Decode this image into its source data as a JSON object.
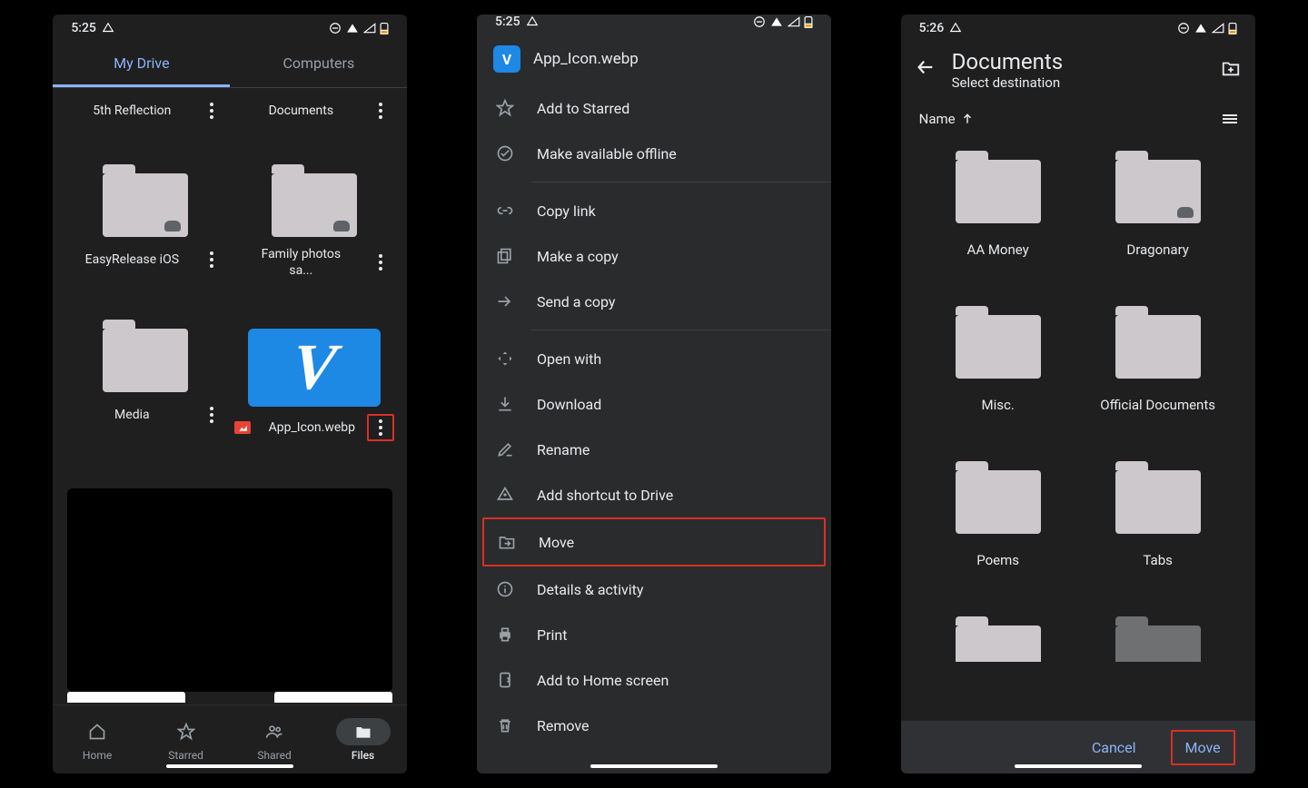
{
  "status": {
    "time1": "5:25",
    "time2": "5:25",
    "time3": "5:26"
  },
  "screen1": {
    "tabs": {
      "mydrive": "My Drive",
      "computers": "Computers"
    },
    "items": {
      "reflection": "5th Reflection",
      "documents": "Documents",
      "easyrelease": "EasyRelease iOS",
      "familyphotos": "Family photos sa...",
      "media": "Media",
      "appicon": "App_Icon.webp"
    },
    "nav": {
      "home": "Home",
      "starred": "Starred",
      "shared": "Shared",
      "files": "Files"
    }
  },
  "screen2": {
    "filename": "App_Icon.webp",
    "menu": {
      "star": "Add to Starred",
      "offline": "Make available offline",
      "copylink": "Copy link",
      "makecopy": "Make a copy",
      "sendcopy": "Send a copy",
      "openwith": "Open with",
      "download": "Download",
      "rename": "Rename",
      "shortcut": "Add shortcut to Drive",
      "move": "Move",
      "details": "Details & activity",
      "print": "Print",
      "homescreen": "Add to Home screen",
      "remove": "Remove"
    }
  },
  "screen3": {
    "title": "Documents",
    "subtitle": "Select destination",
    "sort": "Name",
    "folders": {
      "aamoney": "AA Money",
      "dragonary": "Dragonary",
      "misc": "Misc.",
      "official": "Official Documents",
      "poems": "Poems",
      "tabs": "Tabs"
    },
    "actions": {
      "cancel": "Cancel",
      "move": "Move"
    }
  }
}
